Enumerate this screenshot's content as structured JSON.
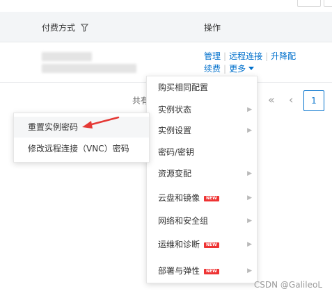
{
  "table": {
    "columns": [
      {
        "label": "付费方式",
        "icon": "filter-icon"
      },
      {
        "label": "操作"
      }
    ],
    "row": {
      "actions": {
        "manage": "管理",
        "remote": "远程连接",
        "upgrade": "升降配",
        "renew": "续费",
        "more": "更多"
      }
    }
  },
  "pagination": {
    "total_label": "共有",
    "first_icon": "«",
    "prev_icon": "‹",
    "current_page": "1"
  },
  "dropdown_menu": {
    "items": [
      {
        "label": "购买相同配置",
        "has_submenu": false,
        "badge": ""
      },
      {
        "label": "实例状态",
        "has_submenu": true,
        "badge": ""
      },
      {
        "label": "实例设置",
        "has_submenu": true,
        "badge": ""
      },
      {
        "label": "密码/密钥",
        "has_submenu": false,
        "badge": ""
      },
      {
        "label": "资源变配",
        "has_submenu": true,
        "badge": ""
      },
      {
        "label": "云盘和镜像",
        "has_submenu": true,
        "badge": "NEW"
      },
      {
        "label": "网络和安全组",
        "has_submenu": true,
        "badge": ""
      },
      {
        "label": "运维和诊断",
        "has_submenu": true,
        "badge": "NEW"
      },
      {
        "label": "部署与弹性",
        "has_submenu": true,
        "badge": "NEW"
      }
    ]
  },
  "submenu": {
    "items": [
      {
        "label": "重置实例密码"
      },
      {
        "label": "修改远程连接（VNC）密码"
      }
    ]
  },
  "watermark": "CSDN @GalileoL",
  "colors": {
    "link": "#0070cc",
    "badge": "#e33333",
    "arrow": "#e53935"
  }
}
